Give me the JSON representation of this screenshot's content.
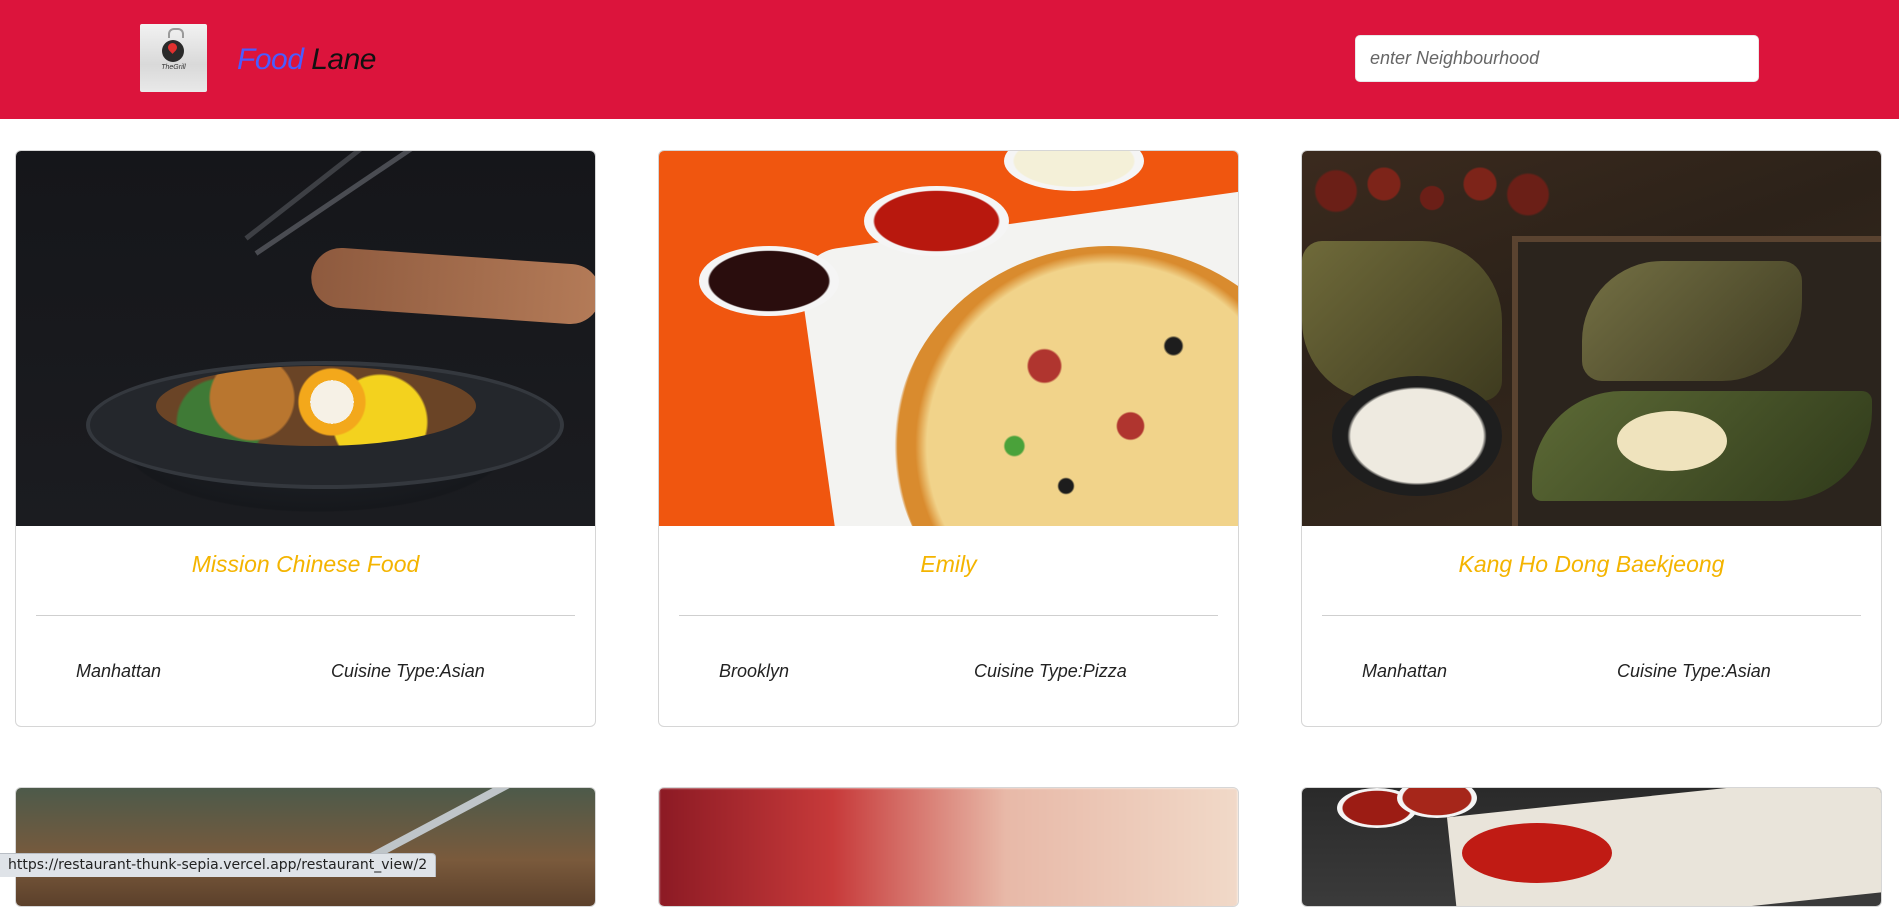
{
  "header": {
    "brand_word1": "Food",
    "brand_word2": "Lane",
    "logo_text": "TheGrill",
    "search_placeholder": "enter Neighbourhood",
    "background_color": "#dc143c",
    "brand_accent_color": "#4a5cff"
  },
  "restaurants": [
    {
      "name": "Mission Chinese Food",
      "neighborhood": "Manhattan",
      "cuisine": "Cuisine Type:Asian",
      "image": "ramen-bowl-photo"
    },
    {
      "name": "Emily",
      "neighborhood": "Brooklyn",
      "cuisine": "Cuisine Type:Pizza",
      "image": "pizza-photo"
    },
    {
      "name": "Kang Ho Dong Baekjeong",
      "neighborhood": "Manhattan",
      "cuisine": "Cuisine Type:Asian",
      "image": "zongzi-photo"
    },
    {
      "image": "steak-board-photo"
    },
    {
      "image": "blurred-restaurant-photo"
    },
    {
      "image": "grilled-pepper-photo"
    }
  ],
  "status_bar": {
    "url": "https://restaurant-thunk-sepia.vercel.app/restaurant_view/2"
  },
  "colors": {
    "title": "#f4b400",
    "card_border": "#d6d6d6"
  }
}
